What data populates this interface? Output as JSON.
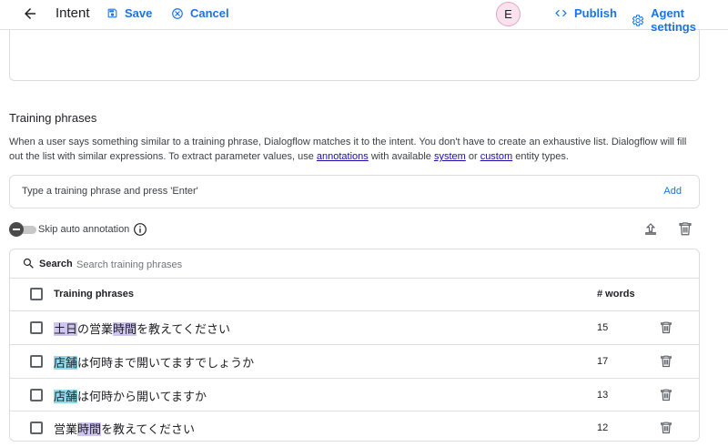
{
  "header": {
    "title": "Intent",
    "save_label": "Save",
    "cancel_label": "Cancel",
    "avatar_initial": "E",
    "publish_label": "Publish",
    "agent_settings_label": "Agent settings"
  },
  "training": {
    "section_title": "Training phrases",
    "desc_part1": "When a user says something similar to a training phrase, Dialogflow matches it to the intent. You don't have to create an exhaustive list. Dialogflow will fill out the list with similar expressions. To extract parameter values, use ",
    "desc_link_annotations": "annotations",
    "desc_part2": " with available ",
    "desc_link_system": "system",
    "desc_part3": " or ",
    "desc_link_custom": "custom",
    "desc_part4": " entity types.",
    "input_placeholder": "Type a training phrase and press 'Enter'",
    "add_label": "Add",
    "skip_auto_annotation_label": "Skip auto annotation",
    "search_label": "Search",
    "search_placeholder": "Search training phrases",
    "col_phrases": "Training phrases",
    "col_words": "# words",
    "rows": [
      {
        "segments": [
          {
            "text": "土日",
            "hl": "a"
          },
          {
            "text": "の営業",
            "hl": ""
          },
          {
            "text": "時間",
            "hl": "a"
          },
          {
            "text": "を教えてください",
            "hl": ""
          }
        ],
        "words": "15"
      },
      {
        "segments": [
          {
            "text": "店舗",
            "hl": "b"
          },
          {
            "text": "は何時まで開いてますでしょうか",
            "hl": ""
          }
        ],
        "words": "17"
      },
      {
        "segments": [
          {
            "text": "店舗",
            "hl": "b"
          },
          {
            "text": "は何時から開いてますか",
            "hl": ""
          }
        ],
        "words": "13"
      },
      {
        "segments": [
          {
            "text": "営業",
            "hl": ""
          },
          {
            "text": "時間",
            "hl": "a"
          },
          {
            "text": "を教えてください",
            "hl": ""
          }
        ],
        "words": "12"
      }
    ]
  },
  "colors": {
    "accent": "#1a73e8",
    "highlight_a": "#cfc6ef",
    "highlight_b": "#8fdcec",
    "avatar_bg": "#f8e2ee"
  }
}
